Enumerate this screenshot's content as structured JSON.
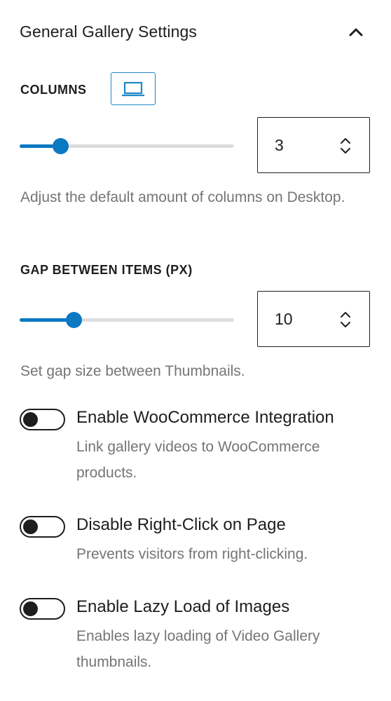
{
  "panel": {
    "title": "General Gallery Settings"
  },
  "columns": {
    "label": "COLUMNS",
    "device_icon": "desktop-laptop-icon",
    "value": "3",
    "slider_fraction": 0.19,
    "help": "Adjust the default amount of columns on Desktop."
  },
  "gap": {
    "label": "GAP BETWEEN ITEMS (PX)",
    "value": "10",
    "slider_fraction": 0.25,
    "help": "Set gap size between Thumbnails."
  },
  "toggles": [
    {
      "label": "Enable WooCommerce Integration",
      "help": "Link gallery videos to WooCommerce products.",
      "checked": false
    },
    {
      "label": "Disable Right-Click on Page",
      "help": "Prevents visitors from right-clicking.",
      "checked": false
    },
    {
      "label": "Enable Lazy Load of Images",
      "help": "Enables lazy loading of Video Gallery thumbnails.",
      "checked": false
    }
  ],
  "colors": {
    "accent": "#0b78c2",
    "text": "#1e1e1e",
    "help_text": "#757575",
    "track": "#dddddd"
  }
}
